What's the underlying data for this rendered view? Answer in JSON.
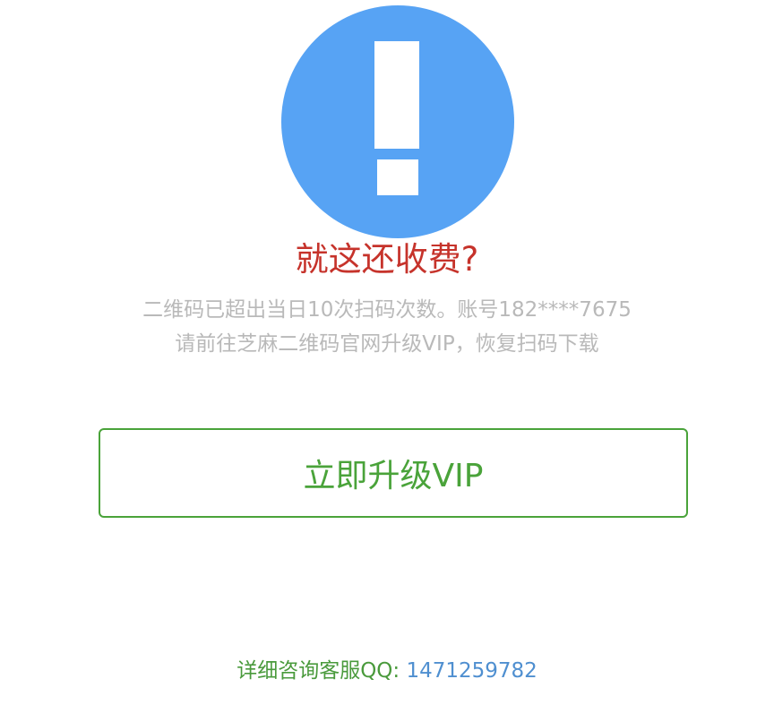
{
  "alert": {
    "icon": "exclamation-icon",
    "circle_color": "#57a3f4"
  },
  "headline": "就这还收费?",
  "message": {
    "line1": "二维码已超出当日10次扫码次数。账号182****7675",
    "line2": "请前往芝麻二维码官网升级VIP，恢复扫码下载"
  },
  "upgrade_button": {
    "label": "立即升级VIP"
  },
  "contact": {
    "label": "详细咨询客服QQ: ",
    "number": "1471259782"
  },
  "colors": {
    "headline": "#c6332b",
    "message": "#b9b9b9",
    "accent_green": "#4aa33a",
    "link_blue": "#4f8fd0"
  }
}
